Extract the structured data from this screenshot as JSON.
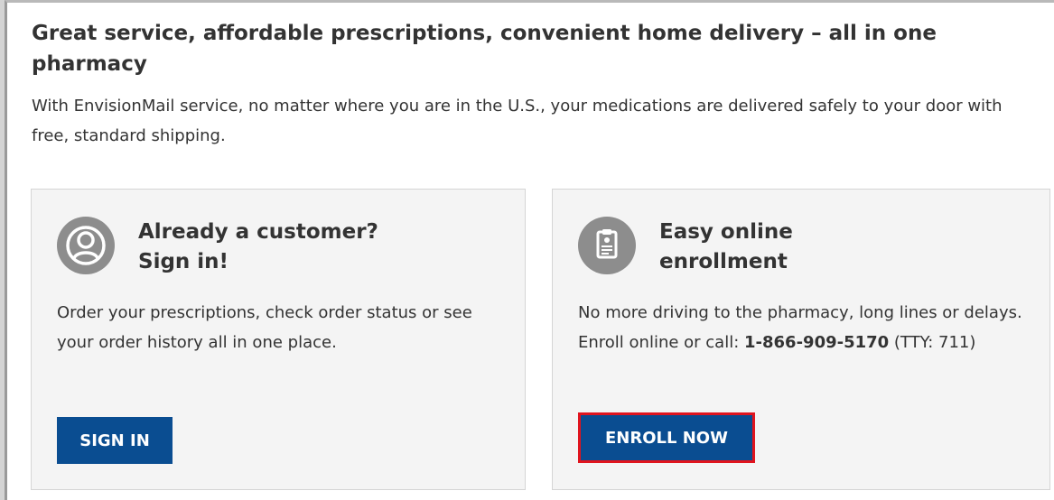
{
  "header": {
    "headline": "Great service, affordable prescriptions, convenient home delivery – all in one pharmacy",
    "intro": "With EnvisionMail service, no matter where you are in the U.S., your medications are delivered safely to your door with free, standard shipping."
  },
  "cards": {
    "signin": {
      "icon": "user-icon",
      "title_line1": "Already a customer?",
      "title_line2": "Sign in!",
      "text": "Order your prescriptions, check order status or see your order history all in one place.",
      "button_label": "SIGN IN"
    },
    "enroll": {
      "icon": "clipboard-icon",
      "title_line1": "Easy online",
      "title_line2": "enrollment",
      "text_before": "No more driving to the pharmacy, long lines or delays. Enroll online or call: ",
      "phone": "1-866-909-5170",
      "text_after": " (TTY: 711)",
      "button_label": "ENROLL NOW"
    }
  },
  "colors": {
    "button": "#0a4d91",
    "highlight": "#e0141e",
    "card_bg": "#f4f4f4",
    "icon_bg": "#8d8d8d",
    "text": "#333333"
  }
}
